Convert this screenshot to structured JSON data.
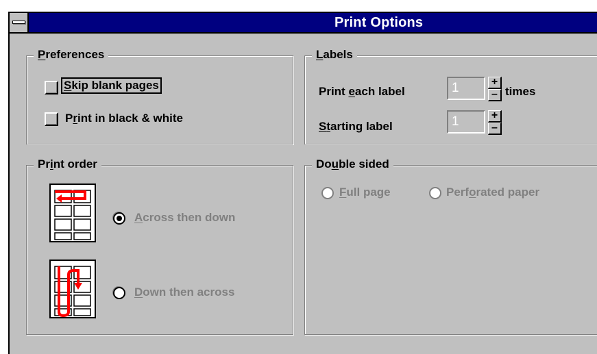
{
  "window": {
    "title": "Print Options"
  },
  "preferences": {
    "heading_pre": "",
    "heading_u": "P",
    "heading_post": "references",
    "skip_u": "S",
    "skip_post": "kip blank pages",
    "bw_pre": "P",
    "bw_u": "r",
    "bw_post": "int in black & white"
  },
  "labels": {
    "heading_u": "L",
    "heading_post": "abels",
    "each_pre": "Print ",
    "each_u": "e",
    "each_post": "ach label",
    "each_value": "1",
    "times": "times",
    "start_u": "S",
    "start_u2": "t",
    "start_post": "arting label",
    "start_value": "1",
    "spin_up": "+",
    "spin_down": "–"
  },
  "print_order": {
    "heading_pre": "Pr",
    "heading_u": "i",
    "heading_post": "nt order",
    "across_u": "A",
    "across_post": "cross then down",
    "down_u": "D",
    "down_post": "own then across",
    "selected": "across"
  },
  "double_sided": {
    "heading_pre": "Do",
    "heading_u": "u",
    "heading_post": "ble sided",
    "full_u": "F",
    "full_post": "ull page",
    "perf_pre": "Perf",
    "perf_u": "o",
    "perf_post": "rated paper"
  },
  "colors": {
    "title_bar": "#000080",
    "arrow": "#ff0000",
    "face": "#c0c0c0"
  }
}
